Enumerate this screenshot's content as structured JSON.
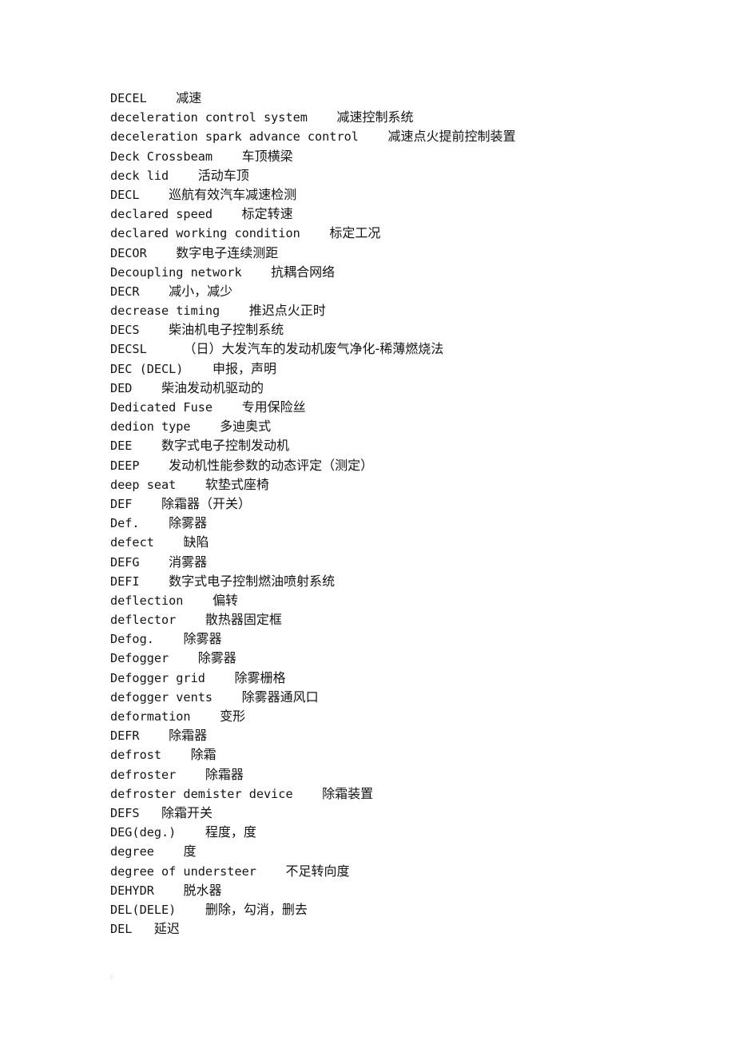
{
  "page": {
    "kind": "scanned-document-page",
    "background_color": "#ffffff",
    "text_color": "#141414",
    "language_pair": "English-Chinese",
    "section_letter": "D"
  },
  "glossary": {
    "entries": [
      {
        "term": "DECEL",
        "gap": "    ",
        "gloss": "减速"
      },
      {
        "term": "deceleration control system",
        "gap": "    ",
        "gloss": "减速控制系统"
      },
      {
        "term": "deceleration spark advance control",
        "gap": "    ",
        "gloss": "减速点火提前控制装置"
      },
      {
        "term": "Deck Crossbeam",
        "gap": "    ",
        "gloss": "车顶横梁"
      },
      {
        "term": "deck lid",
        "gap": "    ",
        "gloss": "活动车顶"
      },
      {
        "term": "DECL",
        "gap": "    ",
        "gloss": "巡航有效汽车减速检测"
      },
      {
        "term": "declared speed",
        "gap": "    ",
        "gloss": "标定转速"
      },
      {
        "term": "declared working condition",
        "gap": "    ",
        "gloss": "标定工况"
      },
      {
        "term": "DECOR",
        "gap": "    ",
        "gloss": "数字电子连续测距"
      },
      {
        "term": "Decoupling network",
        "gap": "    ",
        "gloss": "抗耦合网络"
      },
      {
        "term": "DECR",
        "gap": "    ",
        "gloss": "减小，减少"
      },
      {
        "term": "decrease timing",
        "gap": "    ",
        "gloss": "推迟点火正时"
      },
      {
        "term": "DECS",
        "gap": "    ",
        "gloss": "柴油机电子控制系统"
      },
      {
        "term": "DECSL",
        "gap": "     ",
        "gloss": "（日）大发汽车的发动机废气净化-稀薄燃烧法"
      },
      {
        "term": "DEC (DECL)",
        "gap": "    ",
        "gloss": "申报，声明"
      },
      {
        "term": "DED",
        "gap": "    ",
        "gloss": "柴油发动机驱动的"
      },
      {
        "term": "Dedicated Fuse",
        "gap": "    ",
        "gloss": "专用保险丝"
      },
      {
        "term": "dedion type",
        "gap": "    ",
        "gloss": "多迪奥式"
      },
      {
        "term": "DEE",
        "gap": "    ",
        "gloss": "数字式电子控制发动机"
      },
      {
        "term": "DEEP",
        "gap": "    ",
        "gloss": "发动机性能参数的动态评定（测定）"
      },
      {
        "term": "deep seat",
        "gap": "    ",
        "gloss": "软垫式座椅"
      },
      {
        "term": "DEF",
        "gap": "    ",
        "gloss": "除霜器（开关）"
      },
      {
        "term": "Def.",
        "gap": "    ",
        "gloss": "除雾器"
      },
      {
        "term": "defect",
        "gap": "    ",
        "gloss": "缺陷"
      },
      {
        "term": "DEFG",
        "gap": "    ",
        "gloss": "消雾器"
      },
      {
        "term": "DEFI",
        "gap": "    ",
        "gloss": "数字式电子控制燃油喷射系统"
      },
      {
        "term": "deflection",
        "gap": "    ",
        "gloss": "偏转"
      },
      {
        "term": "deflector",
        "gap": "    ",
        "gloss": "散热器固定框"
      },
      {
        "term": "Defog.",
        "gap": "    ",
        "gloss": "除雾器"
      },
      {
        "term": "Defogger",
        "gap": "    ",
        "gloss": "除雾器"
      },
      {
        "term": "Defogger grid",
        "gap": "    ",
        "gloss": "除雾栅格"
      },
      {
        "term": "defogger vents",
        "gap": "    ",
        "gloss": "除雾器通风口"
      },
      {
        "term": "deformation",
        "gap": "    ",
        "gloss": "变形"
      },
      {
        "term": "DEFR",
        "gap": "    ",
        "gloss": "除霜器"
      },
      {
        "term": "defrost",
        "gap": "    ",
        "gloss": "除霜"
      },
      {
        "term": "defroster",
        "gap": "    ",
        "gloss": "除霜器"
      },
      {
        "term": "defroster demister device",
        "gap": "    ",
        "gloss": "除霜装置"
      },
      {
        "term": "DEFS",
        "gap": "   ",
        "gloss": "除霜开关"
      },
      {
        "term": "DEG(deg.)",
        "gap": "    ",
        "gloss": "程度，度"
      },
      {
        "term": "degree",
        "gap": "    ",
        "gloss": "度"
      },
      {
        "term": "degree of understeer",
        "gap": "    ",
        "gloss": "不足转向度"
      },
      {
        "term": "DEHYDR",
        "gap": "    ",
        "gloss": "脱水器"
      },
      {
        "term": "DEL(DELE)",
        "gap": "    ",
        "gloss": "删除，勾消，删去"
      },
      {
        "term": "DEL",
        "gap": "   ",
        "gloss": "延迟"
      }
    ]
  }
}
